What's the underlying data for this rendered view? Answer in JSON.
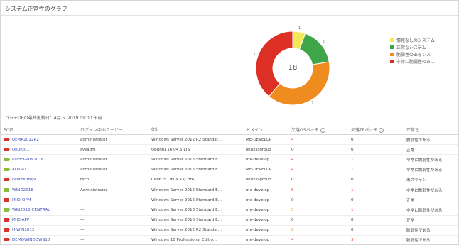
{
  "panel": {
    "title": "システム正常性のグラフ"
  },
  "chart_data": {
    "type": "pie",
    "center_label": "18",
    "categories": [
      "情報なしのシステム",
      "正常なシステム",
      "脆弱性のあるシステム",
      "非常に脆弱性のあるシステム"
    ],
    "values": [
      1,
      3,
      7,
      7
    ],
    "legend_labels": [
      "情報なしのシステム",
      "正常なシステム",
      "脆弱性のあるシス",
      "非常に脆弱性のあ..."
    ],
    "colors": [
      "#f2e85a",
      "#3fa548",
      "#ee8c1f",
      "#dc3024"
    ],
    "legend_position": "right"
  },
  "updated": "パッチDBの最終更新日：4月 5, 2019 09:00 午前",
  "table": {
    "headers": {
      "pc": "PC名",
      "user": "ログイン中のユーザー",
      "os": "OS",
      "domain": "ドメイン",
      "os_patch": "欠落OSパッチ",
      "tp_patch": "欠落TPパッチ",
      "health": "正常性"
    },
    "rows": [
      {
        "pc": "UEMA2012R2",
        "icon": "red",
        "user": "administrator",
        "os": "Windows Server 2012 R2 Standar...",
        "domain": "ME-DEVELOP",
        "os_patch": "4",
        "os_color": "red",
        "tp_patch": "0",
        "tp_color": "gray",
        "health": "脆弱性である"
      },
      {
        "pc": "Ubuntu1",
        "icon": "red",
        "user": "sysadm",
        "os": "Ubuntu 16.04.5 LTS",
        "domain": "linuxssgroup",
        "os_patch": "0",
        "os_color": "gray",
        "tp_patch": "0",
        "tp_color": "gray",
        "health": "正常"
      },
      {
        "pc": "KOHEI-WIN2016",
        "icon": "green",
        "user": "administrator",
        "os": "Windows Server 2016 Standard E...",
        "domain": "me-develop",
        "os_patch": "4",
        "os_color": "red",
        "tp_patch": "1",
        "tp_color": "red",
        "health": "非常に脆弱性がある"
      },
      {
        "pc": "ADSSD",
        "icon": "green",
        "user": "administrator",
        "os": "Windows Server 2016 Standard E...",
        "domain": "ME-DEVELOP",
        "os_patch": "4",
        "os_color": "red",
        "tp_patch": "1",
        "tp_color": "red",
        "health": "非常に脆弱性がある"
      },
      {
        "pc": "centos-tmpl",
        "icon": "red",
        "user": "tech",
        "os": "CentOS Linux 7 (Core)",
        "domain": "linuxssgroup",
        "os_patch": "0",
        "os_color": "gray",
        "tp_patch": "0",
        "tp_color": "gray",
        "health": "未スキャン"
      },
      {
        "pc": "WIND2016",
        "icon": "green",
        "user": "Administrator",
        "os": "Windows Server 2016 Standard E...",
        "domain": "me-develop",
        "os_patch": "6",
        "os_color": "red",
        "tp_patch": "1",
        "tp_color": "red",
        "health": "非常に脆弱性がある"
      },
      {
        "pc": "MIKI-OPM",
        "icon": "red",
        "user": "—",
        "os": "Windows Server 2016 Standard E...",
        "domain": "me-develop",
        "os_patch": "0",
        "os_color": "gray",
        "tp_patch": "0",
        "tp_color": "gray",
        "health": "正常"
      },
      {
        "pc": "WIN2016-CENTRAL",
        "icon": "green",
        "user": "—",
        "os": "Windows Server 2016 Standard E...",
        "domain": "me-develop",
        "os_patch": "5",
        "os_color": "orange",
        "tp_patch": "1",
        "tp_color": "red",
        "health": "非常に脆弱性がある"
      },
      {
        "pc": "MIKI-APP",
        "icon": "red",
        "user": "—",
        "os": "Windows Server 2016 Standard E...",
        "domain": "me-develop",
        "os_patch": "0",
        "os_color": "gray",
        "tp_patch": "0",
        "tp_color": "gray",
        "health": "正常"
      },
      {
        "pc": "H-WIN2012",
        "icon": "red",
        "user": "—",
        "os": "Windows Server 2012 R2 Standar...",
        "domain": "me-develop",
        "os_patch": "6",
        "os_color": "orange",
        "tp_patch": "0",
        "tp_color": "gray",
        "health": "脆弱性である"
      },
      {
        "pc": "DEMOWINDOWS10",
        "icon": "red",
        "user": "—",
        "os": "Windows 10 Professional Editio...",
        "domain": "me-develop",
        "os_patch": "4",
        "os_color": "red",
        "tp_patch": "3",
        "tp_color": "red",
        "health": "脆弱性である"
      }
    ]
  }
}
